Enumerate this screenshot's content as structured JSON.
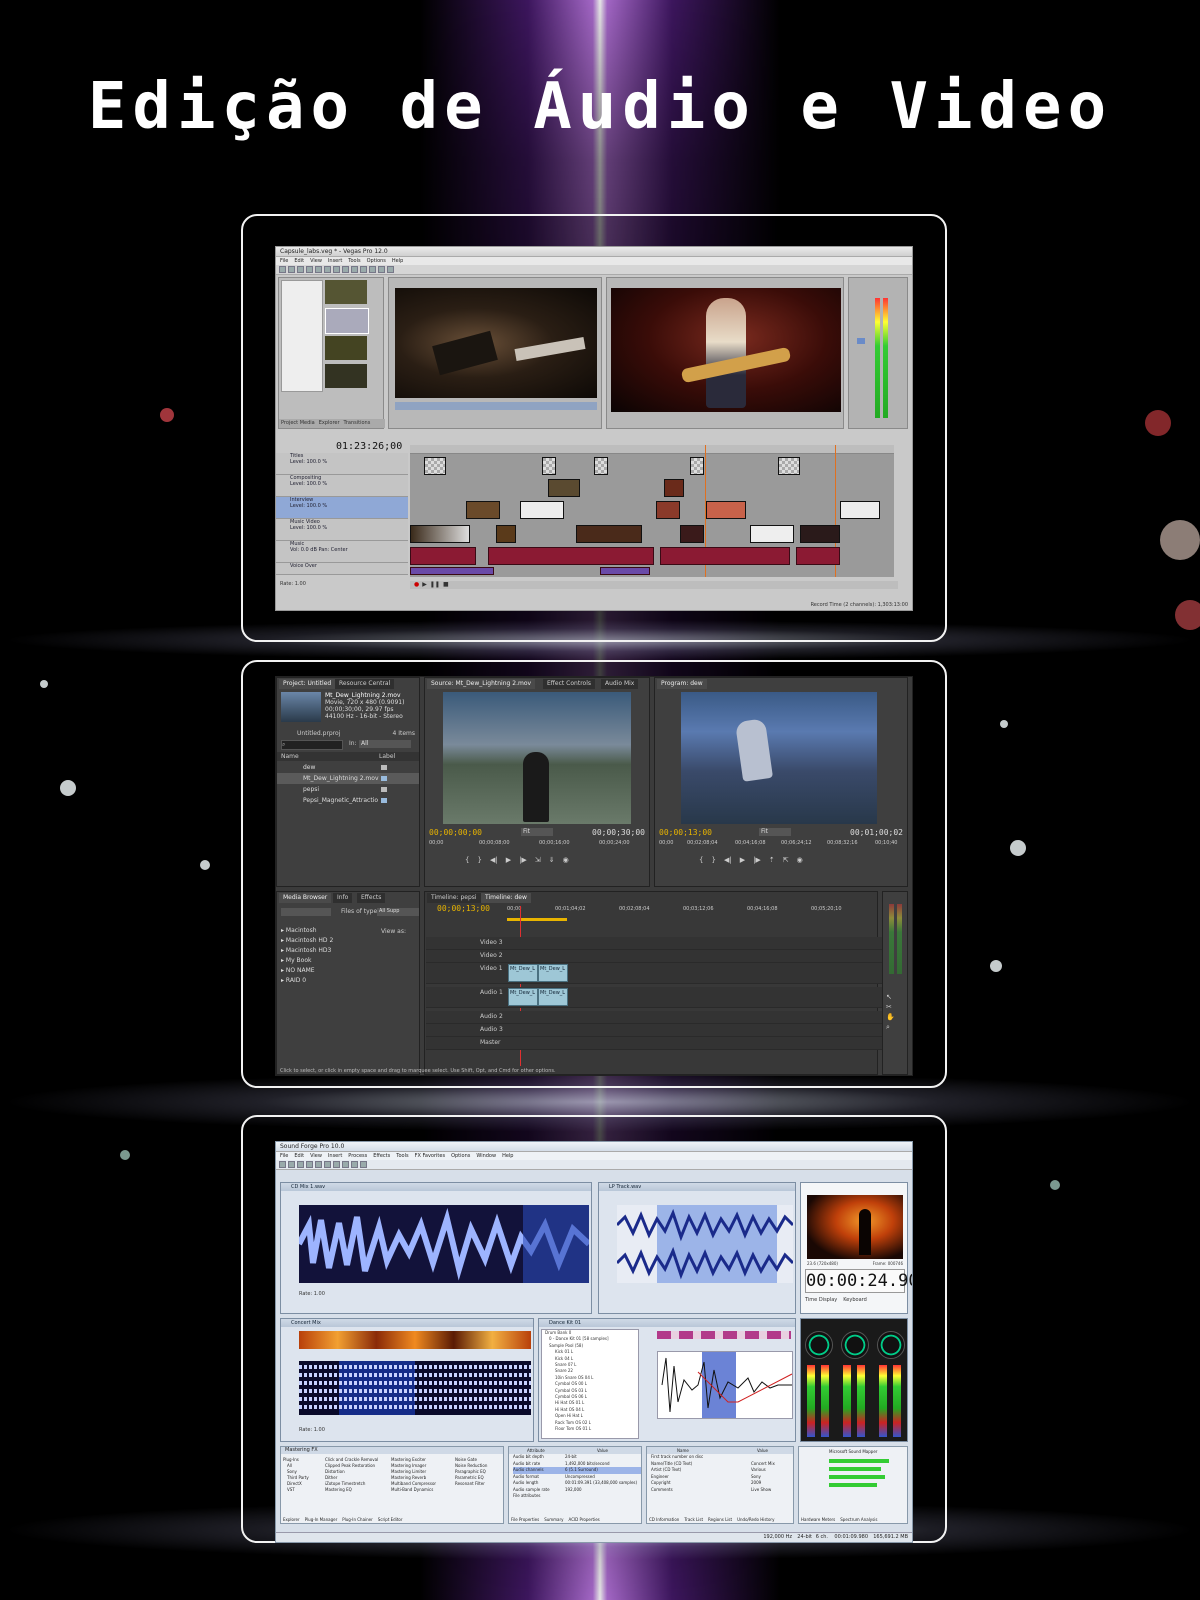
{
  "page": {
    "title": "Edição de Áudio e Video"
  },
  "vegas": {
    "window_title": "Capsule_labs.veg * - Vegas Pro 12.0",
    "menu": [
      "File",
      "Edit",
      "View",
      "Insert",
      "Tools",
      "Options",
      "Help"
    ],
    "timecode": "01:23:26;00",
    "tracks": [
      {
        "name": "Titles",
        "level": "Level: 100.0 %"
      },
      {
        "name": "Compositing",
        "level": "Level: 100.0 %"
      },
      {
        "name": "Interview",
        "level": "Level: 100.0 %"
      },
      {
        "name": "Music Video",
        "level": "Level: 100.0 %"
      },
      {
        "name": "Music",
        "vol": "Vol: 0.0 dB",
        "pan": "Pan: Center"
      },
      {
        "name": "Voice Over"
      }
    ],
    "rate": "Rate: 1.00",
    "tabs": [
      "Project Media",
      "Explorer",
      "Transitions"
    ],
    "record_time": "Record Time (2 channels): 1,303:13:00"
  },
  "premiere": {
    "project_tabs": [
      "Project: Untitled",
      "Resource Central"
    ],
    "source_tabs": [
      "Source: Mt_Dew_Lightning 2.mov",
      "Effect Controls",
      "Audio Mix"
    ],
    "program_tab": "Program: dew",
    "clip_info": {
      "name": "Mt_Dew_Lightning 2.mov",
      "line1": "Movie, 720 x 480 (0.9091)",
      "line2": "00;00;30;00, 29.97 fps",
      "line3": "44100 Hz - 16-bit - Stereo"
    },
    "project_file": "Untitled.prproj",
    "item_count": "4 Items",
    "in_label": "In:",
    "in_value": "All",
    "columns": [
      "Name",
      "Label"
    ],
    "items": [
      "dew",
      "Mt_Dew_Lightning 2.mov",
      "pepsi",
      "Pepsi_Magnetic_Attractio"
    ],
    "source_tc_left": "00;00;00;00",
    "source_fit": "Fit",
    "source_tc_right": "00;00;30;00",
    "source_ruler": [
      "00;00",
      "00;00;08;00",
      "00;00;16;00",
      "00;00;24;00"
    ],
    "program_tc_left": "00;00;13;00",
    "program_fit": "Fit",
    "program_tc_right": "00;01;00;02",
    "program_ruler": [
      "00;00",
      "00;02;08;04",
      "00;04;16;08",
      "00;06;24;12",
      "00;08;32;16",
      "00;10;40"
    ],
    "browser_tabs": [
      "Media Browser",
      "Info",
      "Effects"
    ],
    "files_of_type": "Files of type:",
    "files_value": "All Supp",
    "view_as": "View as:",
    "drives": [
      "Macintosh",
      "Macintosh HD 2",
      "Macintosh HD3",
      "My Book",
      "NO NAME",
      "RAID 0"
    ],
    "timeline_tabs": [
      "Timeline: pepsi",
      "Timeline: dew"
    ],
    "timeline_tc": "00;00;13;00",
    "timeline_ruler": [
      "00;00",
      "00;01;04;02",
      "00;02;08;04",
      "00;03;12;06",
      "00;04;16;08",
      "00;05;20;10"
    ],
    "tracks": [
      "Video 3",
      "Video 2",
      "Video 1",
      "Audio 1",
      "Audio 2",
      "Audio 3",
      "Master"
    ],
    "clip_label": "Mt_Dew_L",
    "v_label": "V",
    "a_label": "A1",
    "status": "Click to select, or click in empty space and drag to marquee select. Use Shift, Opt, and Cmd for other options."
  },
  "soundforge": {
    "window_title": "Sound Forge Pro 10.0",
    "menu": [
      "File",
      "Edit",
      "View",
      "Insert",
      "Process",
      "Effects",
      "Tools",
      "FX Favorites",
      "Options",
      "Window",
      "Help"
    ],
    "win1": "CD Mix 1.wav",
    "win2": "LP Track.wav",
    "win3": "Concert Mix",
    "win4": "Dance Kit 01",
    "rate": "Rate: 1.00",
    "timecode": "00:00:24.906",
    "video_info_left": "23.6 (720x480)",
    "video_info_right": "Frame: 000746",
    "tabs_right": [
      "Time Display",
      "Keyboard"
    ],
    "drum_tree": [
      "Drum Bank 0",
      "0 - Dance Kit 01 [58 samples]",
      "Sample Pool (58)",
      "Kick 01 L",
      "Kick 04 L",
      "Snare 07 L",
      "Snare 22",
      "10in Snare OS 04 L",
      "Cymbal OS 00 L",
      "Cymbal OS 03 L",
      "Cymbal OS 06 L",
      "Hi Hat OS 01 L",
      "Hi Hat OS 04 L",
      "Open Hi Hat L",
      "Rack Tom OS 02 L",
      "Floor Tom OS 01 L"
    ],
    "fx_header": "Mastering FX",
    "plugin_tree": [
      "Plug-Ins",
      "All",
      "Sony",
      "Third Party",
      "DirectX",
      "VST"
    ],
    "fx_items": [
      "Click and Crackle Removal",
      "Clipped Peak Restoration",
      "Distortion",
      "Dither",
      "iZotope Timestretch",
      "Mastering EQ",
      "Mastering Exciter",
      "Mastering Imager",
      "Mastering Limiter",
      "Mastering Reverb",
      "Multiband Compressor",
      "Multi-Band Dynamics",
      "Noise Gate",
      "Noise Reduction",
      "Paragraphic EQ",
      "Parametric EQ",
      "Resonant Filter"
    ],
    "bottom_tabs_1": [
      "Explorer",
      "Plug-In Manager",
      "Plug-In Chainer",
      "Script Editor"
    ],
    "attr_header": [
      "Attribute",
      "Value"
    ],
    "attrs": [
      [
        "Audio bit depth",
        "24-bit"
      ],
      [
        "Audio bit rate",
        "1,492,000 bits/second"
      ],
      [
        "Audio channels",
        "6 (5.1 Surround)"
      ],
      [
        "Audio format",
        "Uncompressed"
      ],
      [
        "Audio length",
        "00:01:09.391 (33,408,000 samples)"
      ],
      [
        "Audio sample rate",
        "192,000"
      ],
      [
        "File attributes",
        ""
      ]
    ],
    "bottom_tabs_2": [
      "File Properties",
      "Summary",
      "ACID Properties"
    ],
    "cd_header": [
      "Name",
      "Value"
    ],
    "cd_rows": [
      [
        "First track number on disc",
        ""
      ],
      [
        "Name/Title (CD Text)",
        "Concert Mix"
      ],
      [
        "Artist (CD Text)",
        "Various"
      ],
      [
        "Engineer",
        "Sony"
      ],
      [
        "Copyright",
        "2009"
      ],
      [
        "Comments",
        "Live Show"
      ]
    ],
    "bottom_tabs_3": [
      "CD Information",
      "Track List",
      "Regions List",
      "Undo/Redo History"
    ],
    "mapper": "Microsoft Sound Mapper",
    "bottom_tabs_4": [
      "Hardware Meters",
      "Spectrum Analysis"
    ],
    "status_items": [
      "192,000 Hz",
      "24-bit",
      "6 ch.",
      "00:01:09.980",
      "165,691.2 MB"
    ]
  }
}
